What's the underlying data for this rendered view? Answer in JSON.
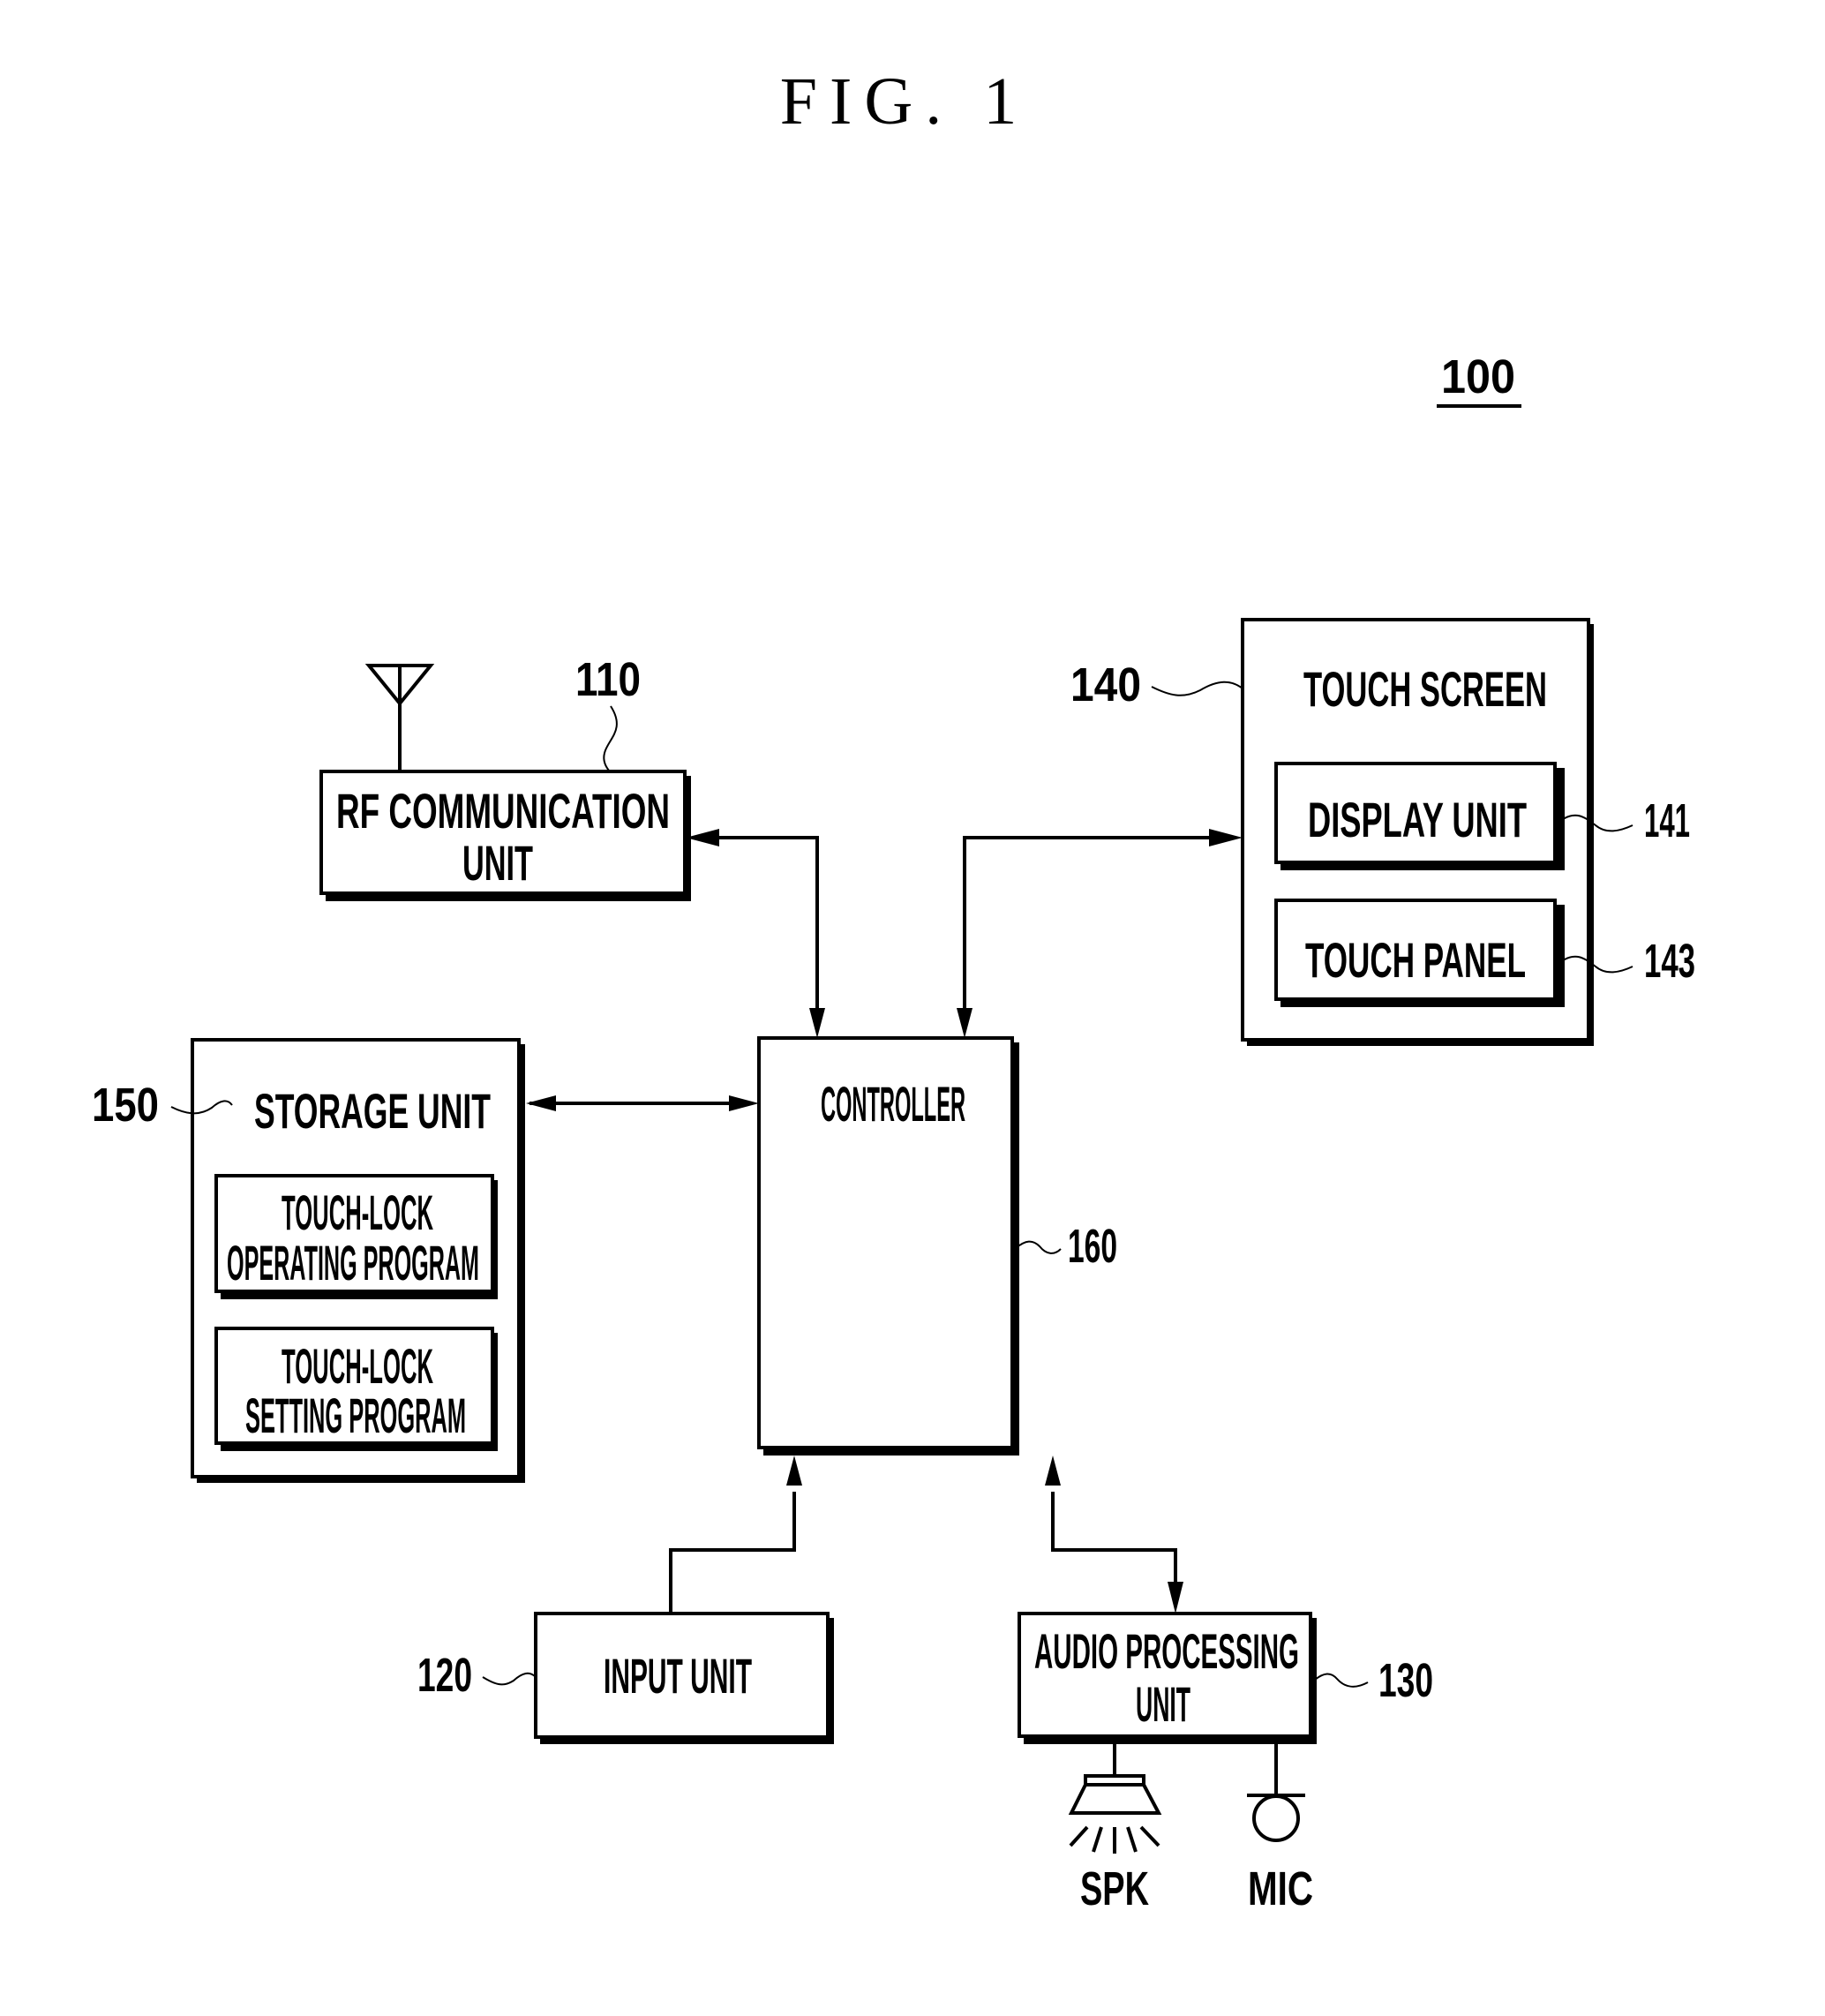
{
  "figure": {
    "title": "FIG. 1",
    "device_ref": "100"
  },
  "blocks": {
    "rf": {
      "ref": "110",
      "line1": "RF COMMUNICATION",
      "line2": "UNIT"
    },
    "touch_screen": {
      "ref": "140",
      "label": "TOUCH SCREEN",
      "display_unit": {
        "ref": "141",
        "label": "DISPLAY UNIT"
      },
      "touch_panel": {
        "ref": "143",
        "label": "TOUCH PANEL"
      }
    },
    "storage": {
      "ref": "150",
      "label": "STORAGE UNIT",
      "operating_program": {
        "line1": "TOUCH-LOCK",
        "line2": "OPERATING PROGRAM"
      },
      "setting_program": {
        "line1": "TOUCH-LOCK",
        "line2": "SETTING PROGRAM"
      }
    },
    "controller": {
      "ref": "160",
      "label": "CONTROLLER"
    },
    "input": {
      "ref": "120",
      "label": "INPUT UNIT"
    },
    "audio": {
      "ref": "130",
      "line1": "AUDIO PROCESSING",
      "line2": "UNIT",
      "speaker_label": "SPK",
      "mic_label": "MIC"
    }
  },
  "connections": [
    {
      "from": "RF COMMUNICATION UNIT",
      "to": "CONTROLLER",
      "direction": "bidirectional"
    },
    {
      "from": "TOUCH SCREEN",
      "to": "CONTROLLER",
      "direction": "bidirectional"
    },
    {
      "from": "STORAGE UNIT",
      "to": "CONTROLLER",
      "direction": "bidirectional"
    },
    {
      "from": "INPUT UNIT",
      "to": "CONTROLLER",
      "direction": "one-way"
    },
    {
      "from": "AUDIO PROCESSING UNIT",
      "to": "CONTROLLER",
      "direction": "bidirectional"
    }
  ]
}
